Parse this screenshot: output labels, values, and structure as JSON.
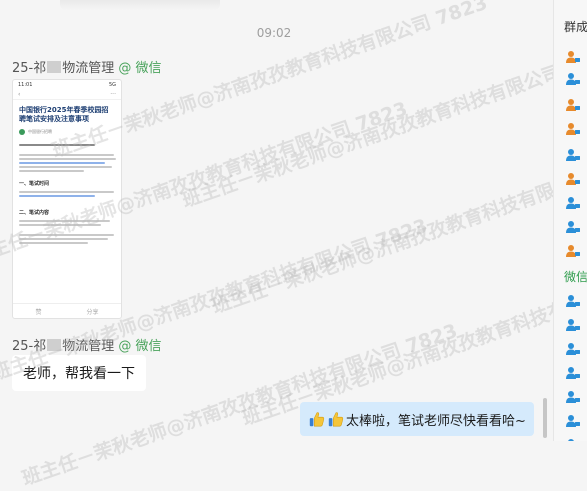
{
  "chat": {
    "timestamp": "09:02",
    "messages": [
      {
        "sender_prefix": "25-祁",
        "sender_suffix": "物流管理",
        "source": "@ 微信"
      },
      {
        "sender_prefix": "25-祁",
        "sender_suffix": "物流管理",
        "source": "@ 微信",
        "text": "老师，帮我看一下"
      },
      {
        "text": "太棒啦，笔试老师尽快看看哈~"
      }
    ]
  },
  "screenshot": {
    "time": "11:01",
    "signal": "5G",
    "title": "中国银行2025年春季校园招聘笔试安排及注意事项",
    "account": "中国银行招聘",
    "section1": "一、笔试时间",
    "section2": "二、笔试内容",
    "bottom_left": "赞",
    "bottom_right": "分享"
  },
  "watermark": "班主任－茉秋老师@济南孜孜教育科技有限公司 7823",
  "side_panel": {
    "header": "群成",
    "subheader": "微信",
    "member_icon_colors": [
      "#e78a2c",
      "#2b8fd8",
      "#e78a2c",
      "#e78a2c",
      "#2b8fd8",
      "#e78a2c",
      "#2b8fd8",
      "#2b8fd8",
      "#e78a2c",
      "#2b8fd8",
      "#2b8fd8",
      "#2b8fd8",
      "#2b8fd8",
      "#2b8fd8",
      "#2b8fd8",
      "#2b8fd8"
    ]
  }
}
